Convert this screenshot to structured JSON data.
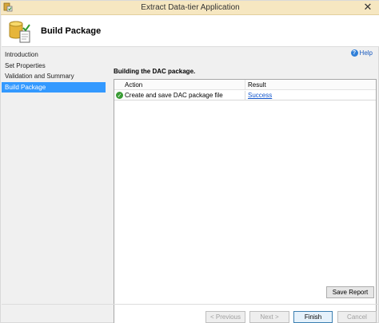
{
  "window": {
    "title": "Extract Data-tier Application",
    "close_glyph": "✕"
  },
  "header": {
    "title": "Build Package",
    "icon": "database-package-icon"
  },
  "sidebar": {
    "items": [
      {
        "label": "Introduction",
        "active": false
      },
      {
        "label": "Set Properties",
        "active": false
      },
      {
        "label": "Validation and Summary",
        "active": false
      },
      {
        "label": "Build Package",
        "active": true
      }
    ]
  },
  "main": {
    "help_label": "Help",
    "help_icon_glyph": "?",
    "section_title": "Building the DAC package.",
    "grid": {
      "columns": [
        "Action",
        "Result"
      ],
      "rows": [
        {
          "action": "Create and save DAC package file",
          "result": "Success",
          "status_glyph": "✓"
        }
      ]
    },
    "save_report_label": "Save Report"
  },
  "footer": {
    "previous_label": "< Previous",
    "next_label": "Next >",
    "finish_label": "Finish",
    "cancel_label": "Cancel"
  },
  "colors": {
    "titlebar": "#f6e7c1",
    "selection": "#3399ff",
    "success": "#3a9c35",
    "link": "#1155cc"
  }
}
